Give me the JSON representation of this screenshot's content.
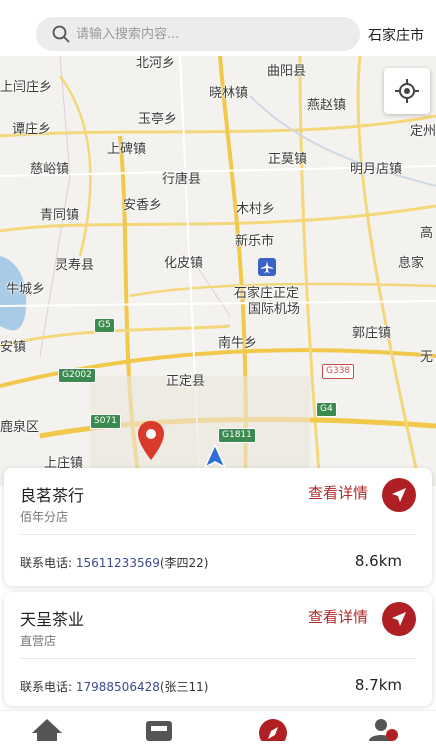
{
  "search": {
    "placeholder": "请输入搜索内容..."
  },
  "city": "石家庄市",
  "map": {
    "places": [
      {
        "name": "北河乡"
      },
      {
        "name": "曲阳县"
      },
      {
        "name": "上闫庄乡"
      },
      {
        "name": "晓林镇"
      },
      {
        "name": "燕赵镇"
      },
      {
        "name": "玉亭乡"
      },
      {
        "name": "谭庄乡"
      },
      {
        "name": "定州"
      },
      {
        "name": "上碑镇"
      },
      {
        "name": "正莫镇"
      },
      {
        "name": "慈峪镇"
      },
      {
        "name": "明月店镇"
      },
      {
        "name": "行唐县"
      },
      {
        "name": "安香乡"
      },
      {
        "name": "木村乡"
      },
      {
        "name": "青同镇"
      },
      {
        "name": "新乐市"
      },
      {
        "name": "高"
      },
      {
        "name": "灵寿县"
      },
      {
        "name": "化皮镇"
      },
      {
        "name": "息家"
      },
      {
        "name": "牛城乡"
      },
      {
        "name": "石家庄正定"
      },
      {
        "name": "国际机场"
      },
      {
        "name": "安镇"
      },
      {
        "name": "南牛乡"
      },
      {
        "name": "郭庄镇"
      },
      {
        "name": "无"
      },
      {
        "name": "正定县"
      },
      {
        "name": "鹿泉区"
      },
      {
        "name": "上庄镇"
      }
    ],
    "roads": [
      "G5",
      "G2002",
      "G338",
      "G4",
      "S071",
      "G1811"
    ]
  },
  "stores": [
    {
      "name": "良茗茶行",
      "type": "佰年分店",
      "detail_label": "查看详情",
      "phone_label": "联系电话:",
      "phone": "15611233569",
      "contact": "(李四22)",
      "distance": "8.6km"
    },
    {
      "name": "天呈茶业",
      "type": "直营店",
      "detail_label": "查看详情",
      "phone_label": "联系电话:",
      "phone": "17988506428",
      "contact": "(张三11)",
      "distance": "8.7km"
    }
  ],
  "colors": {
    "accent": "#b01f24",
    "phone": "#3c4a8e"
  }
}
